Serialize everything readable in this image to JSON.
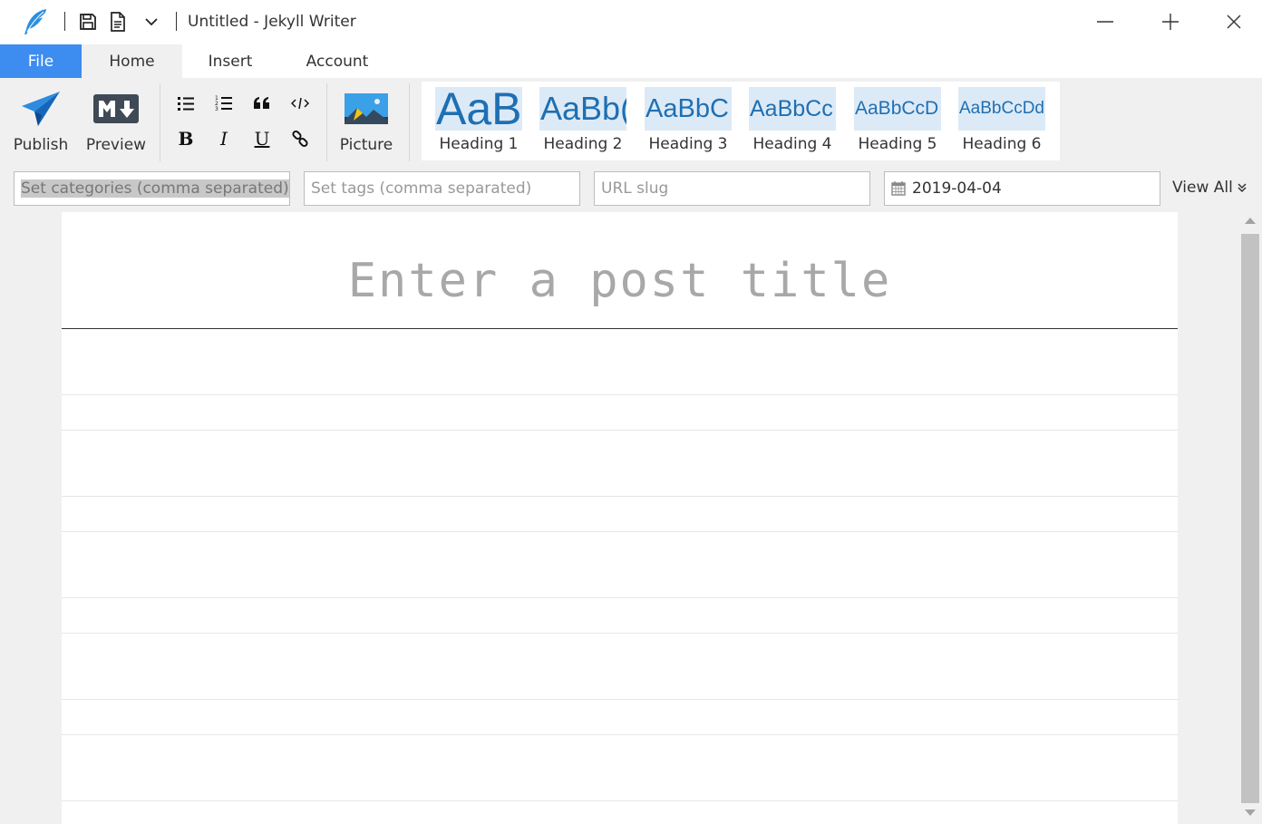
{
  "window": {
    "title": "Untitled - Jekyll Writer",
    "accent_color": "#3d8cf0",
    "icons": [
      "feather-icon",
      "save-icon",
      "new-document-icon",
      "chevron-down-icon",
      "minimize-icon",
      "maximize-icon",
      "close-icon"
    ]
  },
  "tabs": [
    {
      "label": "File",
      "active": false
    },
    {
      "label": "Home",
      "active": true
    },
    {
      "label": "Insert",
      "active": false
    },
    {
      "label": "Account",
      "active": false
    }
  ],
  "ribbon": {
    "publish_label": "Publish",
    "preview_label": "Preview",
    "picture_label": "Picture",
    "format_buttons": {
      "bullet_list": "bullet-list-icon",
      "numbered_list": "numbered-list-icon",
      "quote": "quote-icon",
      "code": "code-icon",
      "bold": "B",
      "italic": "I",
      "underline": "U",
      "link": "link-icon"
    },
    "styles": [
      {
        "preview": "AaB",
        "label": "Heading 1"
      },
      {
        "preview": "AaBb(",
        "label": "Heading 2"
      },
      {
        "preview": "AaBbC",
        "label": "Heading 3"
      },
      {
        "preview": "AaBbCc",
        "label": "Heading 4"
      },
      {
        "preview": "AaBbCcD",
        "label": "Heading 5"
      },
      {
        "preview": "AaBbCcDd",
        "label": "Heading 6"
      }
    ]
  },
  "meta": {
    "categories_placeholder": "Set categories (comma separated)",
    "tags_placeholder": "Set tags (comma separated)",
    "slug_placeholder": "URL slug",
    "date_value": "2019-04-04",
    "view_all_label": "View All"
  },
  "editor": {
    "title_placeholder": "Enter a post title"
  }
}
